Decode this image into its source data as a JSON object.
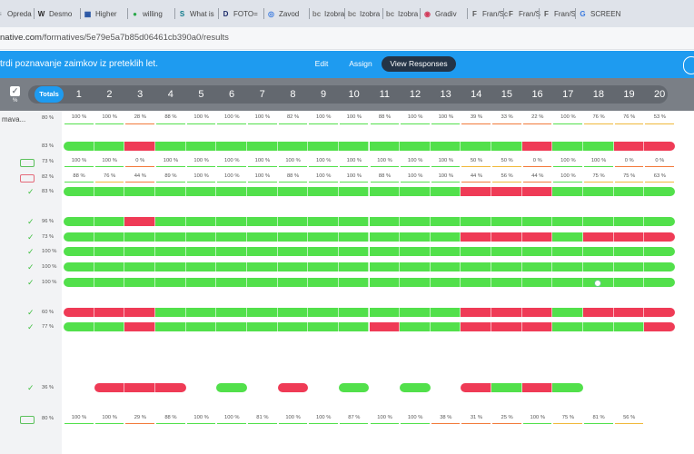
{
  "browser": {
    "tabs": [
      {
        "icon": "≡",
        "label": "Opreda",
        "color": "#8a8f96"
      },
      {
        "icon": "W",
        "label": "Desmo",
        "color": "#2a2a2a"
      },
      {
        "icon": "▦",
        "label": "Higher",
        "color": "#1a4a9e"
      },
      {
        "icon": "●",
        "label": "willing",
        "color": "#2aa84a"
      },
      {
        "icon": "S",
        "label": "What is",
        "color": "#0f7a8a"
      },
      {
        "icon": "D",
        "label": "FOTO=",
        "color": "#1b2a6a"
      },
      {
        "icon": "◎",
        "label": "Zavod",
        "color": "#3a7adf"
      },
      {
        "icon": "bc",
        "label": "Izobra",
        "color": "#777"
      },
      {
        "icon": "bc",
        "label": "Izobra",
        "color": "#777"
      },
      {
        "icon": "bc",
        "label": "Izobra",
        "color": "#777"
      },
      {
        "icon": "◉",
        "label": "Gradiv",
        "color": "#d23a5a"
      },
      {
        "icon": "F",
        "label": "Fran/Sc",
        "color": "#555"
      },
      {
        "icon": "F",
        "label": "Fran/S",
        "color": "#555"
      },
      {
        "icon": "F",
        "label": "Fran/S",
        "color": "#555"
      },
      {
        "icon": "G",
        "label": "SCREEN",
        "color": "#3a7adf"
      }
    ],
    "url_visible": "native.com",
    "url_path": "/formatives/5e79e5a7b85d06461cb390a0/results"
  },
  "assignment_bar": {
    "title": "trdi poznavanje zaimkov iz preteklih let.",
    "buttons": [
      "Edit",
      "Assign",
      "View Responses"
    ],
    "active": "View Responses"
  },
  "header": {
    "totals_label": "Totals",
    "check_sub": "%",
    "questions": [
      "1",
      "2",
      "3",
      "4",
      "5",
      "6",
      "7",
      "8",
      "9",
      "10",
      "11",
      "12",
      "13",
      "14",
      "15",
      "16",
      "17",
      "18",
      "19",
      "20"
    ]
  },
  "colors": {
    "correct": "#52e04b",
    "incorrect": "#ef3b56",
    "blue": "#1e9bf0",
    "header_grey": "#7a7f86"
  },
  "summary_top": {
    "name": "mava...",
    "total": "80 %",
    "values": [
      "100 %",
      "100 %",
      "28 %",
      "88 %",
      "100 %",
      "100 %",
      "100 %",
      "82 %",
      "100 %",
      "100 %",
      "88 %",
      "100 %",
      "100 %",
      "39 %",
      "33 %",
      "22 %",
      "100 %",
      "76 %",
      "76 %",
      "53 %"
    ]
  },
  "summary_bottom": {
    "total": "80 %",
    "values": [
      "100 %",
      "100 %",
      "29 %",
      "88 %",
      "100 %",
      "100 %",
      "81 %",
      "100 %",
      "100 %",
      "87 %",
      "100 %",
      "100 %",
      "38 %",
      "31 %",
      "25 %",
      "100 %",
      "75 %",
      "81 %",
      "56 %"
    ]
  },
  "rows": [
    {
      "total": "83 %",
      "icon": "none",
      "pattern": "GGRGGGGGGGGGGGGRGGRR"
    },
    {
      "total": "73 %",
      "icon": "green-pill",
      "values": [
        "100 %",
        "100 %",
        "0 %",
        "100 %",
        "100 %",
        "100 %",
        "100 %",
        "100 %",
        "100 %",
        "100 %",
        "100 %",
        "100 %",
        "100 %",
        "50 %",
        "50 %",
        "0 %",
        "100 %",
        "100 %",
        "0 %",
        "0 %"
      ]
    },
    {
      "total": "82 %",
      "icon": "red-pill",
      "values": [
        "88 %",
        "76 %",
        "44 %",
        "89 %",
        "100 %",
        "100 %",
        "100 %",
        "88 %",
        "100 %",
        "100 %",
        "88 %",
        "100 %",
        "100 %",
        "44 %",
        "56 %",
        "44 %",
        "100 %",
        "75 %",
        "75 %",
        "63 %"
      ]
    },
    {
      "total": "83 %",
      "icon": "check",
      "pattern": "GGGGGGGGGGGGGRRRGGGG"
    },
    {
      "total": "96 %",
      "icon": "check",
      "pattern": "GGRGGGGGGGGGGGGGGGGG"
    },
    {
      "total": "73 %",
      "icon": "check",
      "pattern": "GGGGGGGGGGGGGRRRGRRR"
    },
    {
      "total": "100 %",
      "icon": "check",
      "pattern": "GGGGGGGGGGGGGGGGGGGG"
    },
    {
      "total": "100 %",
      "icon": "check",
      "pattern": "GGGGGGGGGGGGGGGGGGGG"
    },
    {
      "total": "100 %",
      "icon": "check",
      "pattern": "GGGGGGGGGGGGGGGGGGGG"
    },
    {
      "total": "60 %",
      "icon": "check",
      "pattern": "RRRGGGGGGGGGGRRRGRRR"
    },
    {
      "total": "77 %",
      "icon": "check",
      "pattern": "GGRGGGGGGGRGGRRRGGGR"
    },
    {
      "total": "36 %",
      "icon": "check",
      "pattern": "_RRR_G_R_G_G_RGRG___"
    }
  ]
}
